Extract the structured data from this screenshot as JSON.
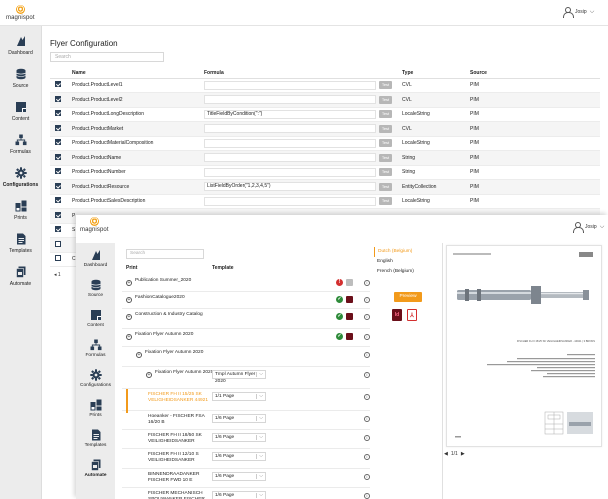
{
  "app": {
    "logo_text": "magnispot",
    "user_name": "Josip"
  },
  "sidebar": {
    "items": [
      {
        "label": "Dashboard",
        "icon": "dashboard-icon",
        "active": false
      },
      {
        "label": "Source",
        "icon": "database-icon",
        "active": false
      },
      {
        "label": "Content",
        "icon": "content-icon",
        "active": false
      },
      {
        "label": "Formulas",
        "icon": "formulas-icon",
        "active": false
      },
      {
        "label": "Configurations",
        "icon": "gear-icon",
        "active": true
      },
      {
        "label": "Prints",
        "icon": "prints-icon",
        "active": false
      },
      {
        "label": "Templates",
        "icon": "templates-icon",
        "active": false
      },
      {
        "label": "Automate",
        "icon": "automate-icon",
        "active": false
      }
    ]
  },
  "flyer_config": {
    "title": "Flyer Configuration",
    "search_placeholder": "Search",
    "columns": [
      "Name",
      "Formula",
      "Type",
      "Source"
    ],
    "test_label": "Test",
    "rows": [
      {
        "checked": true,
        "name": "Product.ProductLevel1",
        "formula": "",
        "type": "CVL",
        "source": "PIM"
      },
      {
        "checked": true,
        "name": "Product.ProductLevel2",
        "formula": "",
        "type": "CVL",
        "source": "PIM"
      },
      {
        "checked": true,
        "name": "Product.ProductLongDescription",
        "formula": "TitleFieldByCondition(\":\")",
        "type": "LocaleString",
        "source": "PIM"
      },
      {
        "checked": true,
        "name": "Product.ProductMarket",
        "formula": "",
        "type": "CVL",
        "source": "PIM"
      },
      {
        "checked": true,
        "name": "Product.ProductMaterialComposition",
        "formula": "",
        "type": "LocaleString",
        "source": "PIM"
      },
      {
        "checked": true,
        "name": "Product.ProductName",
        "formula": "",
        "type": "String",
        "source": "PIM"
      },
      {
        "checked": true,
        "name": "Product.ProductNumber",
        "formula": "",
        "type": "String",
        "source": "PIM"
      },
      {
        "checked": true,
        "name": "Product.ProductResource",
        "formula": "ListFieldByOrder(\"1,2,3,4,5\")",
        "type": "EntityCollection",
        "source": "PIM"
      },
      {
        "checked": true,
        "name": "Product.ProductSalesDescription",
        "formula": "",
        "type": "LocaleString",
        "source": "PIM"
      },
      {
        "checked": true,
        "name": "P",
        "formula": "",
        "type": "",
        "source": ""
      },
      {
        "checked": true,
        "name": "S",
        "formula": "",
        "type": "",
        "source": ""
      },
      {
        "checked": false,
        "name": "",
        "formula": "",
        "type": "",
        "source": ""
      },
      {
        "checked": false,
        "name": "C",
        "formula": "",
        "type": "",
        "source": ""
      }
    ],
    "pager": "◂ 1"
  },
  "prints": {
    "search_placeholder": "Search",
    "col_print": "Print",
    "col_template": "Template",
    "rows": [
      {
        "label": "Publication Summer_2020",
        "template": "",
        "status": [
          "red-alert",
          "grey-square"
        ],
        "level": 0
      },
      {
        "label": "FashionCatalogue2020",
        "template": "",
        "status": [
          "green-check",
          "brown-square"
        ],
        "level": 0
      },
      {
        "label": "Construction & Industry Catalog",
        "template": "",
        "status": [
          "green-check",
          "brown-square"
        ],
        "level": 0
      },
      {
        "label": "Fixation Flyer Autumn 2020",
        "template": "",
        "status": [
          "green-check",
          "brown-square"
        ],
        "level": 0
      },
      {
        "label": "Fixation Flyer Autumn 2020",
        "template": "",
        "status": [],
        "level": 1
      },
      {
        "label": "Fixation Flyer Autumn 2020",
        "template": "Tmpl Autumn Flyer 2020",
        "status": [],
        "level": 2
      },
      {
        "label": "FISCHER FH II 15/25 SK VELIGHEIDSANKER 44921",
        "template": "1/1 Page",
        "status": [],
        "level": 3,
        "highlight": true
      },
      {
        "label": "Hoeanker - FISCHER FSA 16/20 B",
        "template": "1/6 Page",
        "status": [],
        "level": 3
      },
      {
        "label": "FISCHER FH II 18/50 SK VEILIGHEIDSANKER",
        "template": "1/6 Page",
        "status": [],
        "level": 3
      },
      {
        "label": "FISCHER FH II 12/10 S VEILIGHEIDSANKER",
        "template": "1/6 Page",
        "status": [],
        "level": 3
      },
      {
        "label": "BINNENDRAADANKER FISCHER FWD 10 E",
        "template": "1/6 Page",
        "status": [],
        "level": 3
      },
      {
        "label": "FISCHER MECHANISCH SPOUWANKER FISCHER VBE-M 8X255",
        "template": "1/6 Page",
        "status": [],
        "level": 3
      },
      {
        "label": "FISCHER FH II 12/50 H VEILIGHEIDSANKER",
        "template": "1/3 Page",
        "status": [],
        "level": 3
      }
    ],
    "languages": [
      {
        "label": "Dutch (Belgium)",
        "active": true
      },
      {
        "label": "English",
        "active": false
      },
      {
        "label": "French (Belgium)",
        "active": false
      }
    ],
    "preview_label": "Preview",
    "doc_nav": "1/1",
    "doc_caption": "FISCHER FH II 15/25 SK VEILIGHEIDSANKER - 44921 | 3 BRONS"
  },
  "colors": {
    "accent": "#f29a1b",
    "navy": "#2a3e55",
    "sidebar_bg": "#ececec"
  }
}
